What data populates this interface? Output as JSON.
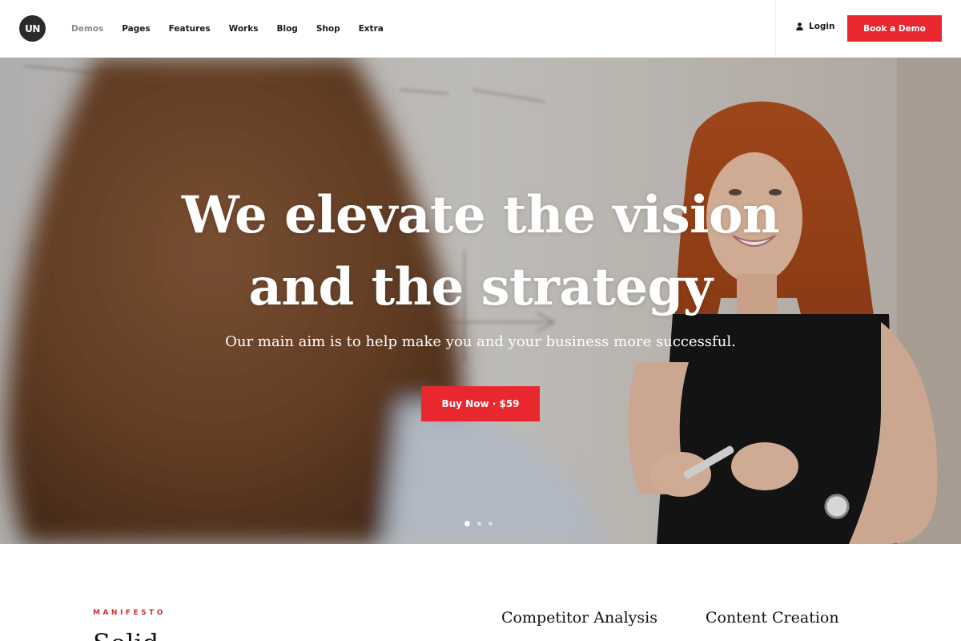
{
  "header": {
    "logo_text": "UN",
    "nav": [
      {
        "label": "Demos",
        "active": true
      },
      {
        "label": "Pages",
        "active": false
      },
      {
        "label": "Features",
        "active": false
      },
      {
        "label": "Works",
        "active": false
      },
      {
        "label": "Blog",
        "active": false
      },
      {
        "label": "Shop",
        "active": false
      },
      {
        "label": "Extra",
        "active": false
      }
    ],
    "login_label": "Login",
    "login_icon": "user-icon",
    "cta_label": "Book a Demo"
  },
  "hero": {
    "title_line1": "We elevate the vision",
    "title_line2": "and the strategy",
    "subtitle": "Our main aim is to help make you and your business more successful.",
    "button_label": "Buy Now · $59",
    "slides_count": 3,
    "active_slide": 1
  },
  "manifesto": {
    "eyebrow": "MANIFESTO",
    "heading_partial": "Solid ...",
    "services": [
      "Competitor Analysis",
      "Content Creation"
    ]
  },
  "colors": {
    "accent": "#e8282e",
    "eyebrow": "#d62b30",
    "header_bg": "#ffffff",
    "text_dark": "#1b1b1b",
    "nav_active": "#8a8a8a"
  }
}
